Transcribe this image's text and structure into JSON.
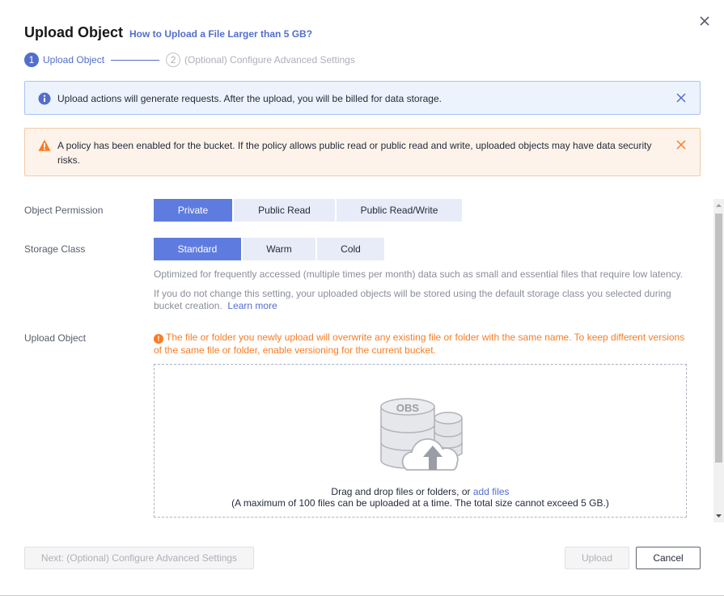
{
  "dialog": {
    "title": "Upload Object",
    "help_link": "How to Upload a File Larger than 5 GB?"
  },
  "steps": [
    {
      "number": "1",
      "label": "Upload Object",
      "state": "active"
    },
    {
      "number": "2",
      "label": "(Optional) Configure Advanced Settings",
      "state": "inactive"
    }
  ],
  "alerts": {
    "info": {
      "text": "Upload actions will generate requests. After the upload, you will be billed for data storage.",
      "icon": "info-icon"
    },
    "warning": {
      "text": "A policy has been enabled for the bucket. If the policy allows public read or public read and write, uploaded objects may have data security risks.",
      "icon": "warning-icon"
    }
  },
  "form": {
    "permission": {
      "label": "Object Permission",
      "options": [
        "Private",
        "Public Read",
        "Public Read/Write"
      ],
      "selected": "Private"
    },
    "storage_class": {
      "label": "Storage Class",
      "options": [
        "Standard",
        "Warm",
        "Cold"
      ],
      "selected": "Standard",
      "description": "Optimized for frequently accessed (multiple times per month) data such as small and essential files that require low latency.",
      "note_line1": "If you do not change this setting, your uploaded objects will be stored using the default storage class you selected during",
      "note_line2": "bucket creation.",
      "learn_more": "Learn more"
    },
    "upload": {
      "label": "Upload Object",
      "warning": "The file or folder you newly upload will overwrite any existing file or folder with the same name. To keep different versions of the same file or folder, enable versioning for the current bucket.",
      "obs_text": "OBS",
      "drop_text": "Drag and drop files or folders, or",
      "add_files": "add files",
      "limit_text": "(A maximum of 100 files can be uploaded at a time. The total size cannot exceed 5 GB.)"
    }
  },
  "footer": {
    "next_button": "Next: (Optional) Configure Advanced Settings",
    "upload_button": "Upload",
    "cancel_button": "Cancel"
  },
  "colors": {
    "accent": "#526ecc",
    "selected_segment": "#5e7ce0",
    "warning": "#fa7c24",
    "info_bg": "#edf3fd",
    "warning_bg": "#fdf3ea"
  }
}
